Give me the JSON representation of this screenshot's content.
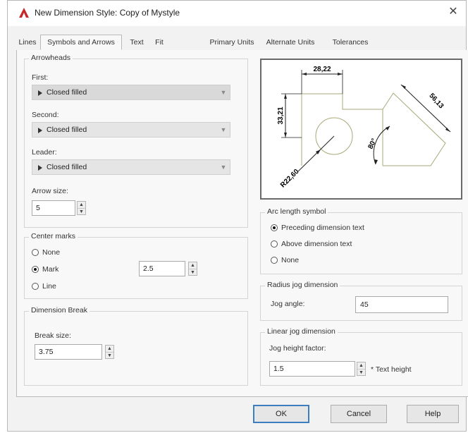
{
  "window": {
    "title": "New Dimension Style: Copy of Mystyle",
    "close_glyph": "✕"
  },
  "tabs": [
    {
      "label": "Lines"
    },
    {
      "label": "Symbols and Arrows"
    },
    {
      "label": "Text"
    },
    {
      "label": "Fit"
    },
    {
      "label": "Primary Units"
    },
    {
      "label": "Alternate Units"
    },
    {
      "label": "Tolerances"
    }
  ],
  "arrowheads": {
    "group_label": "Arrowheads",
    "first_label": "First:",
    "first_value": "Closed filled",
    "second_label": "Second:",
    "second_value": "Closed filled",
    "leader_label": "Leader:",
    "leader_value": "Closed filled",
    "arrow_size_label": "Arrow size:",
    "arrow_size_value": "5"
  },
  "center_marks": {
    "group_label": "Center marks",
    "options": [
      "None",
      "Mark",
      "Line"
    ],
    "selected": "Mark",
    "size_value": "2.5"
  },
  "dimension_break": {
    "group_label": "Dimension Break",
    "break_size_label": "Break size:",
    "break_size_value": "3.75"
  },
  "preview": {
    "dim_top": "28,22",
    "dim_left": "33,21",
    "dim_right": "56,13",
    "dim_angle": "80°",
    "dim_radius": "R22,60"
  },
  "arc_length_symbol": {
    "group_label": "Arc length symbol",
    "options": [
      "Preceding dimension text",
      "Above dimension text",
      "None"
    ],
    "selected": "Preceding dimension text"
  },
  "radius_jog": {
    "group_label": "Radius jog dimension",
    "jog_angle_label": "Jog angle:",
    "jog_angle_value": "45"
  },
  "linear_jog": {
    "group_label": "Linear jog dimension",
    "height_factor_label": "Jog height factor:",
    "height_factor_value": "1.5",
    "suffix": "* Text height"
  },
  "buttons": {
    "ok": "OK",
    "cancel": "Cancel",
    "help": "Help"
  },
  "colors": {
    "accent_red": "#d32f2f",
    "default_button_border": "#3c7fc0",
    "preview_outline": "#9a9a5a"
  }
}
